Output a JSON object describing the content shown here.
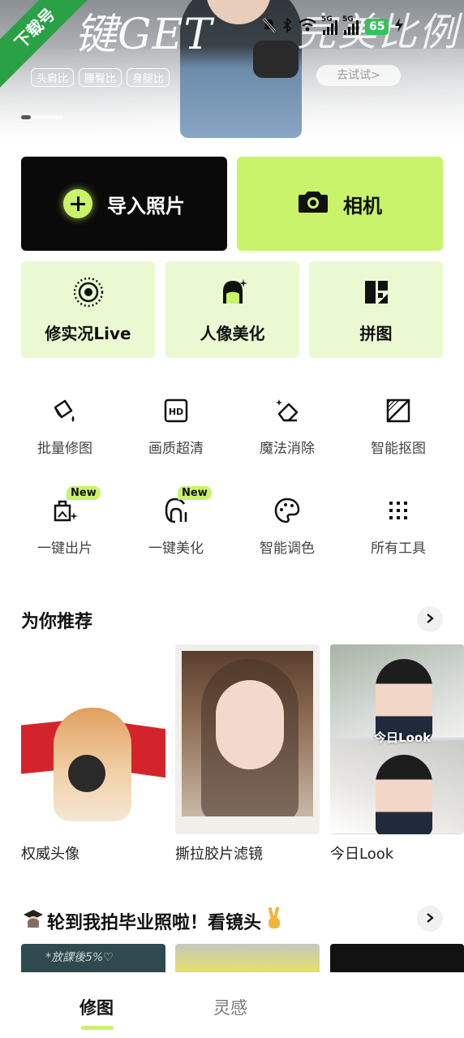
{
  "banner": {
    "ribbon": "下载号",
    "headline_left": "键GET",
    "headline_right": "完美比例",
    "tags": [
      "头肩比",
      "腰臀比",
      "身腿比"
    ],
    "try_button": "去试试>",
    "status": {
      "signal1": "5G",
      "signal2": "5G",
      "battery": "65"
    }
  },
  "primary": {
    "import_label": "导入照片",
    "camera_label": "相机"
  },
  "cards": [
    {
      "label": "修实况Live",
      "icon": "live-photo-icon"
    },
    {
      "label": "人像美化",
      "icon": "portrait-icon"
    },
    {
      "label": "拼图",
      "icon": "collage-icon"
    }
  ],
  "tools": [
    {
      "label": "批量修图",
      "icon": "batch-edit-icon"
    },
    {
      "label": "画质超清",
      "icon": "hd-icon"
    },
    {
      "label": "魔法消除",
      "icon": "magic-eraser-icon"
    },
    {
      "label": "智能抠图",
      "icon": "smart-cutout-icon"
    },
    {
      "label": "一键出片",
      "icon": "one-click-output-icon",
      "badge": "New"
    },
    {
      "label": "一键美化",
      "icon": "one-click-beautify-icon",
      "badge": "New"
    },
    {
      "label": "智能调色",
      "icon": "color-palette-icon"
    },
    {
      "label": "所有工具",
      "icon": "all-tools-grid-icon"
    }
  ],
  "recommend": {
    "title": "为你推荐",
    "items": [
      {
        "caption": "权威头像"
      },
      {
        "caption": "撕拉胶片滤镜"
      },
      {
        "caption": "今日Look",
        "overlay": "今日Look"
      }
    ]
  },
  "graduation": {
    "title": "轮到我拍毕业照啦！看镜头",
    "board_text": "*放課後5%♡"
  },
  "nav": {
    "tabs": [
      "修图",
      "灵感"
    ],
    "active_index": 0
  },
  "colors": {
    "accent": "#c8f36a",
    "card_bg": "#eaf9d1",
    "dark": "#0a0a0a",
    "ribbon": "#2aa146"
  }
}
